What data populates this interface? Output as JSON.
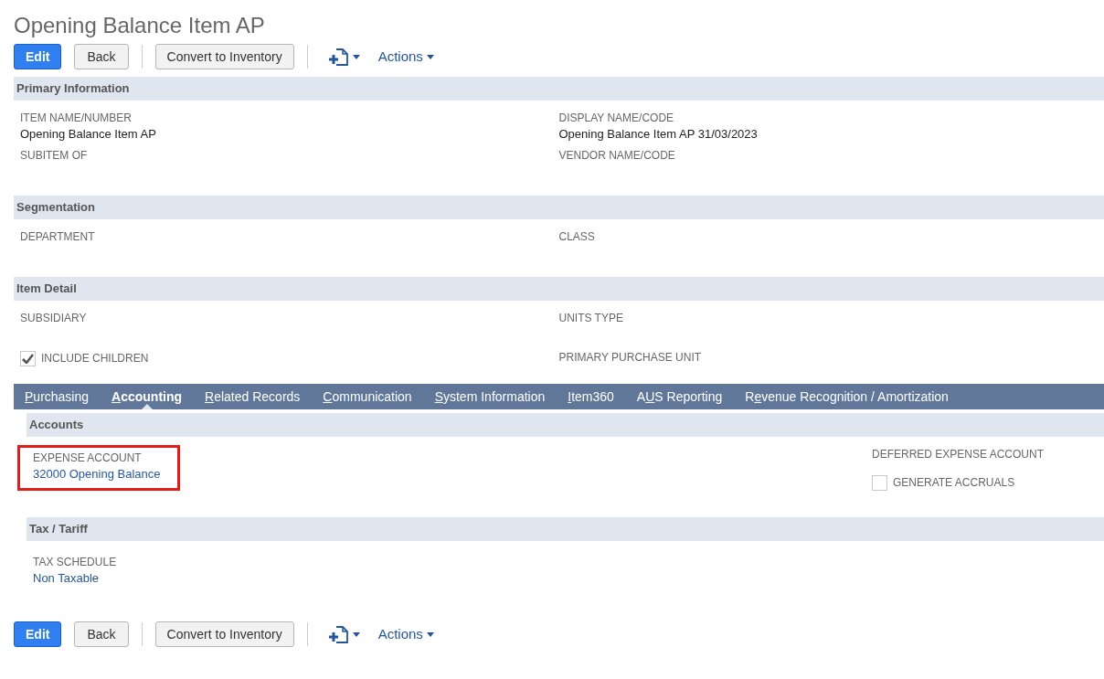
{
  "title": "Opening Balance Item AP",
  "toolbars": [
    {
      "edit": "Edit",
      "back": "Back",
      "convert": "Convert to Inventory",
      "actions": "Actions"
    },
    {
      "edit": "Edit",
      "back": "Back",
      "convert": "Convert to Inventory",
      "actions": "Actions"
    }
  ],
  "sections": [
    {
      "title": "Primary Information",
      "fields": [
        {
          "label": "ITEM NAME/NUMBER",
          "value": "Opening Balance Item AP"
        },
        {
          "label": "DISPLAY NAME/CODE",
          "value": "Opening Balance Item AP 31/03/2023"
        },
        {
          "label": "SUBITEM OF"
        },
        {
          "label": "VENDOR NAME/CODE"
        }
      ]
    },
    {
      "title": "Segmentation",
      "fields": [
        {
          "label": "DEPARTMENT"
        },
        {
          "label": "CLASS"
        }
      ]
    },
    {
      "title": "Item Detail",
      "fields": [
        {
          "label": "SUBSIDIARY"
        },
        {
          "label": "UNITS TYPE"
        },
        {
          "kind": "checkbox",
          "label": "INCLUDE CHILDREN",
          "checked": true
        },
        {
          "label": "PRIMARY PURCHASE UNIT"
        }
      ]
    }
  ],
  "tabs": [
    {
      "key": "P",
      "post": "urchasing",
      "selected": false
    },
    {
      "key": "A",
      "post": "ccounting",
      "selected": true
    },
    {
      "key": "R",
      "post": "elated Records",
      "selected": false
    },
    {
      "key": "C",
      "post": "ommunication",
      "selected": false
    },
    {
      "key": "S",
      "post": "ystem Information",
      "selected": false
    },
    {
      "key": "I",
      "post": "tem360",
      "selected": false
    },
    {
      "pre": "A",
      "key": "U",
      "post": "S Reporting",
      "selected": false
    },
    {
      "pre": "R",
      "key": "e",
      "post": "venue Recognition / Amortization",
      "selected": false
    }
  ],
  "subsections": [
    {
      "title": "Accounts",
      "left": [
        {
          "label": "EXPENSE ACCOUNT",
          "value": "32000 Opening Balance",
          "highlighted": true
        }
      ],
      "right": [
        {
          "label": "DEFERRED EXPENSE ACCOUNT"
        },
        {
          "kind": "checkbox",
          "label": "GENERATE ACCRUALS",
          "checked": false
        }
      ]
    },
    {
      "title": "Tax / Tariff",
      "left": [
        {
          "label": "TAX SCHEDULE",
          "value": "Non Taxable",
          "highlighted": false
        }
      ]
    }
  ]
}
